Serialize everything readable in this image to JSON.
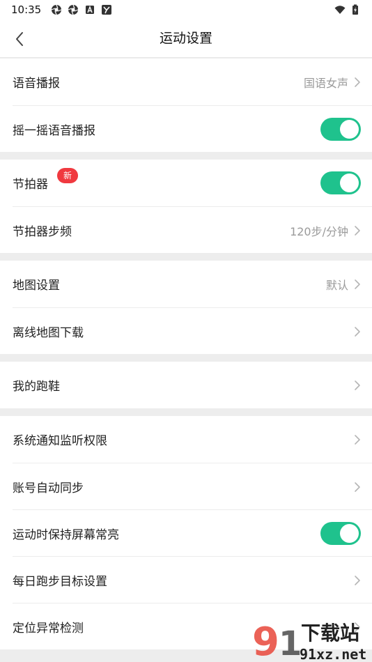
{
  "status_bar": {
    "time": "10:35",
    "left_icons": [
      "aperture-icon",
      "aperture-icon",
      "a-box-icon",
      "y-box-icon"
    ],
    "right_icons": [
      "wifi-icon",
      "battery-charging-icon"
    ]
  },
  "header": {
    "title": "运动设置",
    "back_icon": "chevron-left-icon"
  },
  "groups": [
    {
      "items": [
        {
          "label": "语音播报",
          "value": "国语女声",
          "type": "link"
        },
        {
          "label": "摇一摇语音播报",
          "type": "toggle",
          "on": true
        }
      ]
    },
    {
      "items": [
        {
          "label": "节拍器",
          "type": "toggle",
          "on": true,
          "badge": "新"
        },
        {
          "label": "节拍器步频",
          "value": "120步/分钟",
          "type": "link"
        }
      ]
    },
    {
      "items": [
        {
          "label": "地图设置",
          "value": "默认",
          "type": "link"
        },
        {
          "label": "离线地图下载",
          "type": "link"
        }
      ]
    },
    {
      "items": [
        {
          "label": "我的跑鞋",
          "type": "link"
        }
      ]
    },
    {
      "items": [
        {
          "label": "系统通知监听权限",
          "type": "link"
        },
        {
          "label": "账号自动同步",
          "type": "link"
        },
        {
          "label": "运动时保持屏幕常亮",
          "type": "toggle",
          "on": true
        },
        {
          "label": "每日跑步目标设置",
          "type": "link"
        },
        {
          "label": "定位异常检测",
          "type": "link"
        }
      ]
    }
  ],
  "watermark": {
    "text_top": "下载站",
    "text_bottom": "91xz.net"
  },
  "colors": {
    "accent_green": "#1fc28d",
    "badge_red": "#f0393f",
    "separator": "#ededed"
  }
}
